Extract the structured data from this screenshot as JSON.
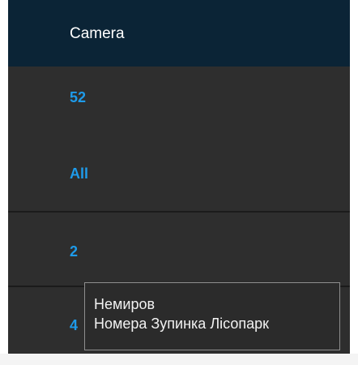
{
  "header": {
    "title": "Camera"
  },
  "rows": [
    {
      "label": "52"
    },
    {
      "label": "All"
    },
    {
      "label": "2"
    },
    {
      "label": "4"
    }
  ],
  "tooltip": {
    "lines": [
      "Немиров",
      "Номера Зупинка Лісопарк"
    ]
  },
  "colors": {
    "header_bg": "#0b2436",
    "row_bg": "#2e2e2e",
    "accent": "#1e9bea",
    "tooltip_border": "#8e8e8e"
  }
}
